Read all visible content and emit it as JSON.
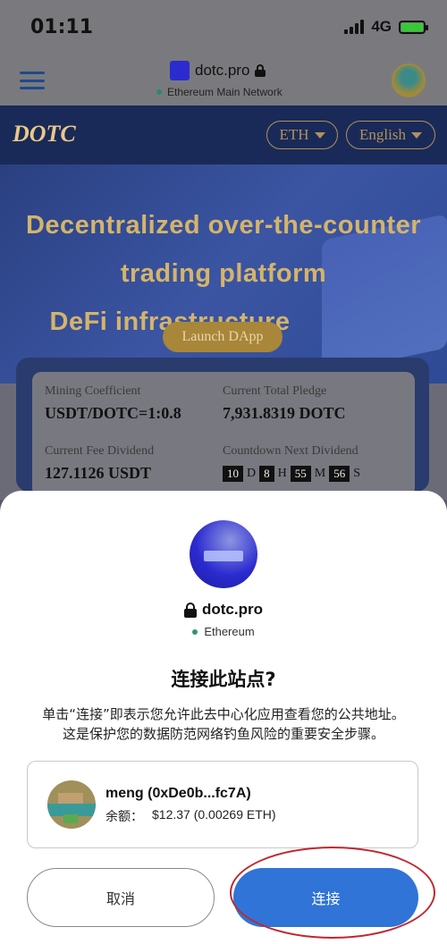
{
  "status_bar": {
    "time": "01:11",
    "network": "4G"
  },
  "browser": {
    "site_name": "dotc.pro",
    "network": "Ethereum Main Network"
  },
  "web_page": {
    "logo_text": "DOTC",
    "currency_selector": "ETH",
    "language_selector": "English",
    "hero_lines": [
      "Decentralized over-the-counter",
      "trading platform",
      "DeFi infrastructure"
    ],
    "launch_button": "Launch DApp",
    "stats": {
      "mining_label": "Mining Coefficient",
      "mining_value": "USDT/DOTC=1:0.8",
      "pledge_label": "Current Total Pledge",
      "pledge_value": "7,931.8319 DOTC",
      "fee_label": "Current Fee Dividend",
      "fee_value": "127.1126 USDT",
      "countdown_label": "Countdown Next Dividend",
      "countdown": {
        "days": "10",
        "d": "D",
        "hours": "8",
        "h": "H",
        "minutes": "55",
        "m": "M",
        "seconds": "56",
        "s": "S"
      }
    }
  },
  "modal": {
    "domain": "dotc.pro",
    "network": "Ethereum",
    "title": "连接此站点?",
    "description_line1": "单击“连接”即表示您允许此去中心化应用查看您的公共地址。",
    "description_line2": "这是保护您的数据防范网络钓鱼风险的重要安全步骤。",
    "account": {
      "name": "meng (0xDe0b...fc7A)",
      "balance_label": "余额：",
      "balance_value": "$12.37 (0.00269 ETH)"
    },
    "cancel_button": "取消",
    "connect_button": "连接"
  },
  "colors": {
    "primary_button": "#2f74d6",
    "annotation_circle": "#c0282e",
    "page_header": "#1a2a58",
    "gold_accent": "#d4b46b"
  }
}
